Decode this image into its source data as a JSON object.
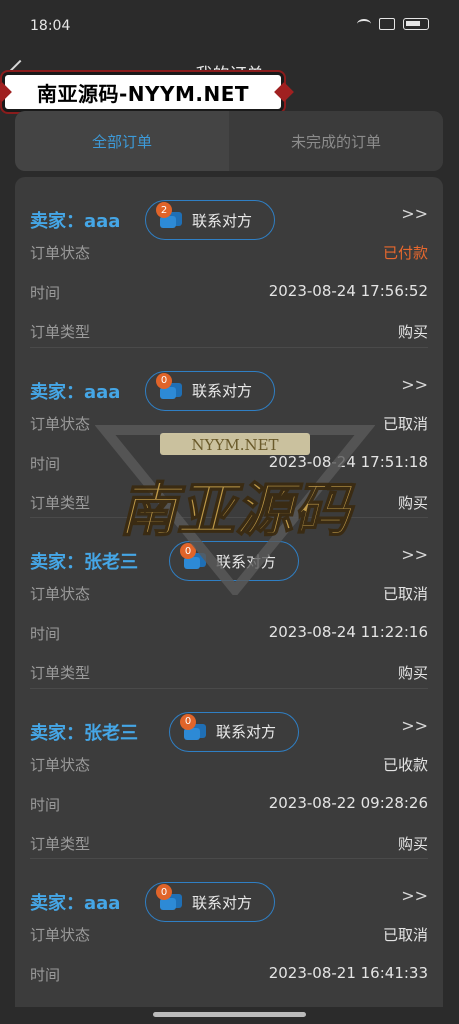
{
  "status_bar": {
    "time": "18:04"
  },
  "title_bar": {
    "title": "我的订单"
  },
  "logo_banner": {
    "text": "南亚源码-NYYM.NET"
  },
  "tabs": [
    {
      "label": "全部订单",
      "active": true
    },
    {
      "label": "未完成的订单",
      "active": false
    }
  ],
  "labels": {
    "status": "订单状态",
    "time": "时间",
    "type": "订单类型",
    "contact": "联系对方",
    "arrow": ">>"
  },
  "orders": [
    {
      "seller": "卖家：aaa",
      "badge": "2",
      "status": "已付款",
      "time": "2023-08-24 17:56:52",
      "type": "购买"
    },
    {
      "seller": "卖家：aaa",
      "badge": "0",
      "status": "已取消",
      "time": "2023-08-24 17:51:18",
      "type": "购买"
    },
    {
      "seller": "卖家：张老三",
      "badge": "0",
      "status": "已取消",
      "time": "2023-08-24 11:22:16",
      "type": "购买"
    },
    {
      "seller": "卖家：张老三",
      "badge": "0",
      "status": "已收款",
      "time": "2023-08-22 09:28:26",
      "type": "购买"
    },
    {
      "seller": "卖家：aaa",
      "badge": "0",
      "status": "已取消",
      "time": "2023-08-21 16:41:33",
      "type": ""
    }
  ],
  "watermark": {
    "top_text": "NYYM.NET",
    "main_text": "南亚源码"
  },
  "colors": {
    "accent": "#3d9ad8",
    "paid": "#e8682e",
    "badge": "#e0642a"
  }
}
